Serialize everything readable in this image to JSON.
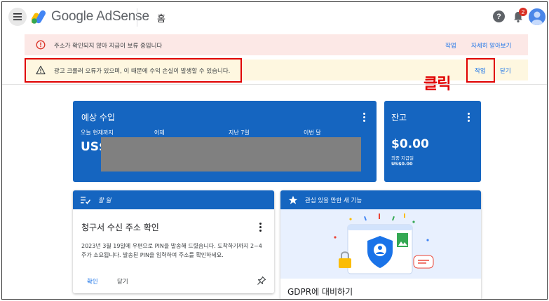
{
  "header": {
    "app_name": "Google AdSense",
    "page_title": "홈",
    "notification_count": "2"
  },
  "banners": {
    "address": {
      "text": "주소가 확인되지 않아 지급이 보류 중입니다",
      "action_label": "작업",
      "learn_more_label": "자세히 알아보기"
    },
    "crawler": {
      "text": "광고 크롤러 오류가 있으며, 이 때문에 수익 손실이 발생할 수 있습니다.",
      "action_label": "작업",
      "dismiss_label": "닫기"
    }
  },
  "annotation": {
    "click_text": "클릭",
    "color": "#e00000"
  },
  "earnings": {
    "title": "예상 수입",
    "columns": [
      "오늘 현재까지",
      "어제",
      "지난 7일",
      "이번 달"
    ],
    "value_prefix": "US$"
  },
  "balance": {
    "title": "잔고",
    "amount": "$0.00",
    "last_payment_label": "최종 지급일",
    "last_payment_value": "US$0.00"
  },
  "todo": {
    "header": "할 일",
    "title": "청구서 수신 주소 확인",
    "body": "2023년 3월 19일에 우편으로 PIN을 발송해 드렸습니다. 도착하기까지 2~4주가 소요됩니다. 발송된 PIN을 입력하여 주소를 확인하세요.",
    "confirm_label": "확인",
    "close_label": "닫기"
  },
  "features": {
    "header": "관심 있을 만한 새 기능",
    "title": "GDPR에 대비하기"
  },
  "colors": {
    "primary_blue": "#1565c0",
    "link_blue": "#1a73e8",
    "error_bg": "#fce8e6",
    "warning_bg": "#fef7e0"
  },
  "icons": [
    "menu-icon",
    "adsense-logo-icon",
    "help-icon",
    "bell-icon",
    "avatar-icon",
    "error-icon",
    "warning-icon",
    "kebab-icon",
    "checklist-icon",
    "star-icon",
    "pin-icon",
    "shield-illustration"
  ]
}
